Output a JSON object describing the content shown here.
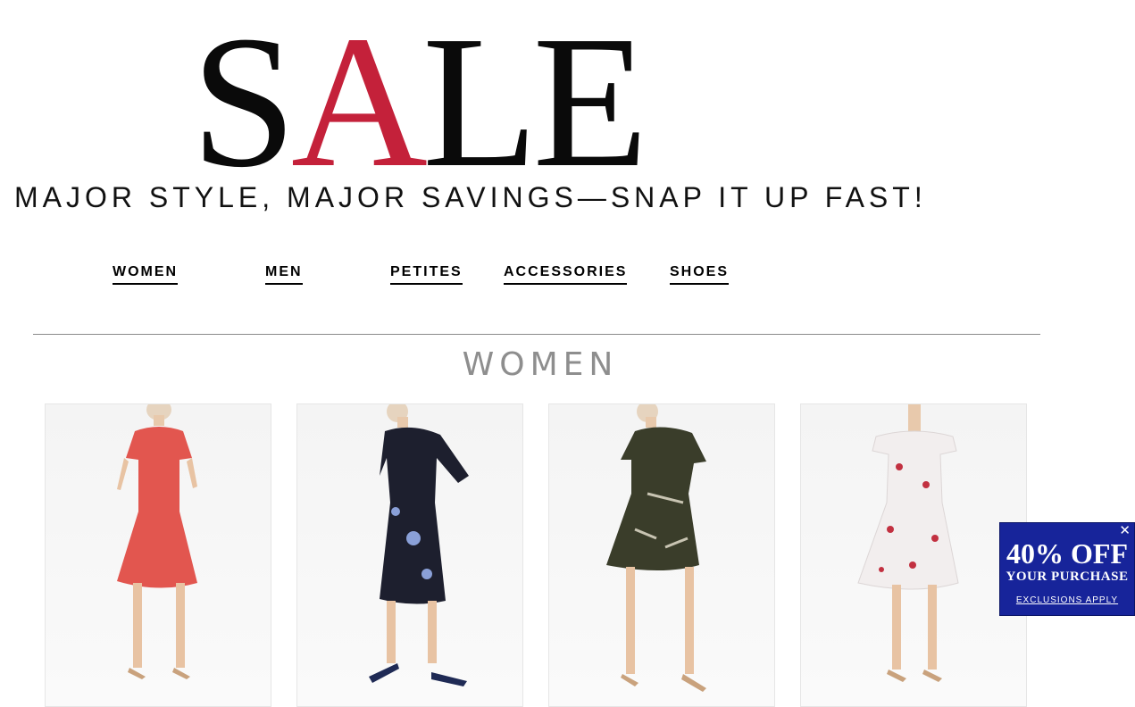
{
  "hero": {
    "title_before": "S",
    "title_accent": "A",
    "title_after": "LE",
    "accent_color": "#c4213a",
    "tagline": "MAJOR STYLE, MAJOR SAVINGS—SNAP IT UP FAST!"
  },
  "nav": {
    "items": [
      {
        "label": "WOMEN"
      },
      {
        "label": "MEN"
      },
      {
        "label": "PETITES"
      },
      {
        "label": "ACCESSORIES"
      },
      {
        "label": "SHOES"
      }
    ]
  },
  "section": {
    "heading": "WOMEN"
  },
  "products": [
    {
      "image": "dress-coral-print-short-sleeve",
      "color": "#e35a5a"
    },
    {
      "image": "dress-navy-floral-shirtdress",
      "color": "#1d1f2e"
    },
    {
      "image": "dress-olive-print-shirtdress",
      "color": "#3a3d2a"
    },
    {
      "image": "dress-white-red-floral-off-shoulder",
      "color": "#f2eeee"
    }
  ],
  "promo": {
    "close_icon": "close-icon",
    "headline": "40% OFF",
    "subline": "YOUR PURCHASE",
    "link": "EXCLUSIONS APPLY",
    "background": "#17249a"
  }
}
